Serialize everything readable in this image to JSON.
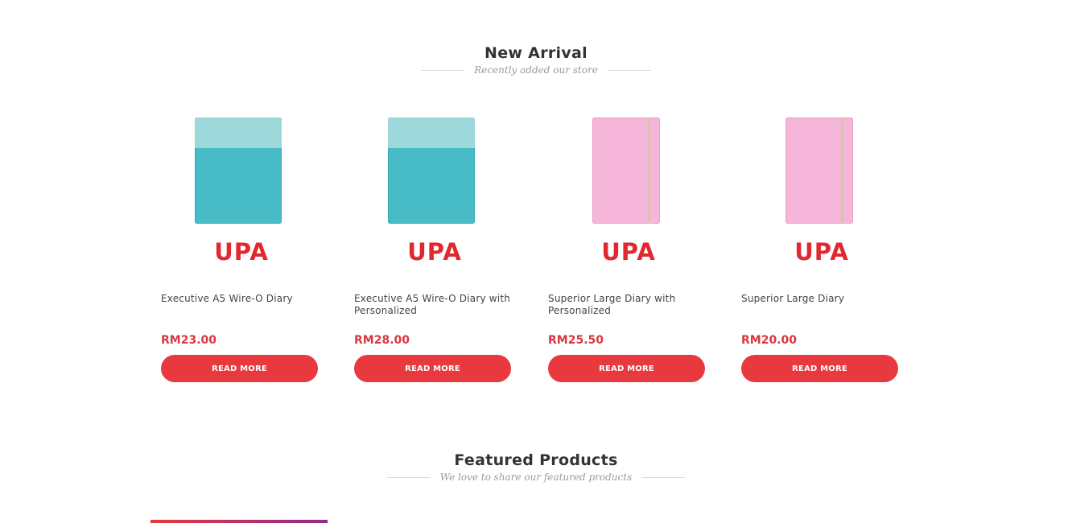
{
  "new_arrival": {
    "title": "New Arrival",
    "subtitle": "Recently added our store"
  },
  "products": [
    {
      "title": "Executive A5 Wire-O Diary",
      "price": "RM23.00",
      "button": "READ MORE",
      "brand": "UPA",
      "image": "teal-notebook"
    },
    {
      "title": "Executive A5 Wire-O Diary with Personalized",
      "price": "RM28.00",
      "button": "READ MORE",
      "brand": "UPA",
      "image": "teal-notebook"
    },
    {
      "title": "Superior Large Diary with Personalized",
      "price": "RM25.50",
      "button": "READ MORE",
      "brand": "UPA",
      "image": "pink-notebook"
    },
    {
      "title": "Superior Large Diary",
      "price": "RM20.00",
      "button": "READ MORE",
      "brand": "UPA",
      "image": "pink-notebook"
    }
  ],
  "featured": {
    "title": "Featured Products",
    "subtitle": "We love to share our featured products"
  },
  "colors": {
    "accent": "#e8393f",
    "price": "#d9373e",
    "brand_logo": "#e2272f",
    "teal_notebook": "#48bcc6",
    "pink_notebook": "#f6b6da"
  }
}
